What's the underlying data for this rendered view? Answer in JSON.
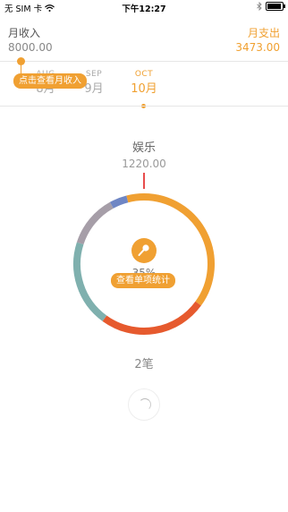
{
  "status_bar": {
    "carrier": "无 SIM 卡",
    "time": "下午12:27"
  },
  "header": {
    "income_label": "月收入",
    "income_value": "8000.00",
    "expense_label": "月支出",
    "expense_value": "3473.00"
  },
  "months": [
    {
      "en": "AUG",
      "cn": "8月"
    },
    {
      "en": "SEP",
      "cn": "9月"
    },
    {
      "en": "OCT",
      "cn": "10月"
    }
  ],
  "tips": {
    "income": "点击查看月收入",
    "category": "查看单项统计"
  },
  "category": {
    "name": "娱乐",
    "amount": "1220.00",
    "percent": "35%",
    "count": "2笔"
  },
  "colors": {
    "accent": "#f0a032",
    "orange_red": "#e65a2e",
    "teal": "#7fb0ae",
    "gray_purple": "#a69ea8",
    "blue": "#6f86c4",
    "pointer": "#e84c4c"
  },
  "chart_data": {
    "type": "pie",
    "variant": "donut",
    "title": "",
    "series": [
      {
        "color": "#f0a032",
        "share": 0.35
      },
      {
        "color": "#e65a2e",
        "share": 0.25
      },
      {
        "color": "#7fb0ae",
        "share": 0.2
      },
      {
        "color": "#a69ea8",
        "share": 0.12
      },
      {
        "color": "#6f86c4",
        "share": 0.04
      },
      {
        "color": "#f0a032",
        "share": 0.04
      }
    ]
  }
}
